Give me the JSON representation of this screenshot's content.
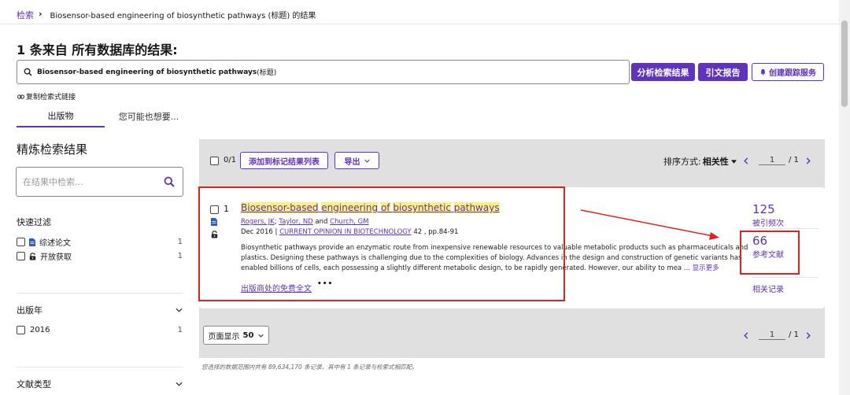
{
  "breadcrumb": {
    "root": "检索",
    "sep": "›",
    "current": "Biosensor-based engineering of biosynthetic pathways (标题) 的结果"
  },
  "page_title": "1 条来自 所有数据库的结果:",
  "search": {
    "query_bold": "Biosensor-based engineering of biosynthetic pathways",
    "query_suffix": " (标题)",
    "analyze_label": "分析检索结果",
    "citation_report_label": "引文报告",
    "create_alert_label": "创建跟踪服务",
    "copy_link_label": "复制检索式链接"
  },
  "tabs": [
    {
      "label": "出版物",
      "active": true
    },
    {
      "label": "您可能也想要..."
    }
  ],
  "refine": {
    "title": "精炼检索结果",
    "search_placeholder": "在结果中检索...",
    "quick_filter_title": "快速过滤",
    "quick_filters": [
      {
        "label": "综述论文",
        "count": "1",
        "icon": "document-icon"
      },
      {
        "label": "开放获取",
        "count": "1",
        "icon": "lock-open-icon"
      }
    ],
    "pub_year_title": "出版年",
    "pub_years": [
      {
        "label": "2016",
        "count": "1"
      }
    ],
    "doc_type_title": "文献类型"
  },
  "toolbar": {
    "selected": "0/1",
    "add_to_list": "添加到标记结果列表",
    "export": "导出",
    "sort_label": "排序方式:",
    "sort_value": "相关性",
    "page": "1",
    "page_total": "/ 1"
  },
  "record": {
    "index": "1",
    "title_parts": [
      {
        "text": "Biosensor-based",
        "hl": true
      },
      {
        "text": " "
      },
      {
        "text": "engineering",
        "hl": true
      },
      {
        "text": " "
      },
      {
        "text": "of",
        "hl": true
      },
      {
        "text": " "
      },
      {
        "text": "biosynthetic",
        "hl": true
      },
      {
        "text": " "
      },
      {
        "text": "pathways",
        "hl": true
      }
    ],
    "author1": "Rogers, JK",
    "author_sep": "; ",
    "author2": "Taylor, ND",
    "author_and": " and ",
    "author3": "Church, GM",
    "date": "Dec 2016",
    "journal_sep": " | ",
    "journal": "CURRENT OPINION IN BIOTECHNOLOGY",
    "volume": " 42 , pp.84-91",
    "abstract_line1": "Biosynthetic pathways provide an enzymatic route from inexpensive renewable resources to valuable metabolic products such as pharmaceuticals and",
    "abstract_line2": "plastics. Designing these pathways is challenging due to the complexities of biology. Advances in the design and construction of genetic variants has",
    "abstract_line3": "enabled billions of cells, each possessing a slightly different metabolic design, to be rapidly generated. However, our ability to mea ... ",
    "show_more": "显示更多",
    "free_full_text": "出版商处的免费全文",
    "more": "•••",
    "times_cited": "125",
    "times_cited_label": "被引频次",
    "references": "66",
    "references_label": "参考文献",
    "related_label": "相关记录"
  },
  "bottom_bar": {
    "page_size_label": "页面显示",
    "page_size_value": "50",
    "page": "1",
    "page_total": "/ 1"
  },
  "footer_note": "您选择的数据范围内共有 89,634,170 条记录。其中有 1 条记录与检索式相匹配。",
  "colors": {
    "accent": "#5e33bf",
    "highlight": "#fff176",
    "annotation": "#e0221e",
    "toolbar_bg": "#e0e0e0"
  }
}
